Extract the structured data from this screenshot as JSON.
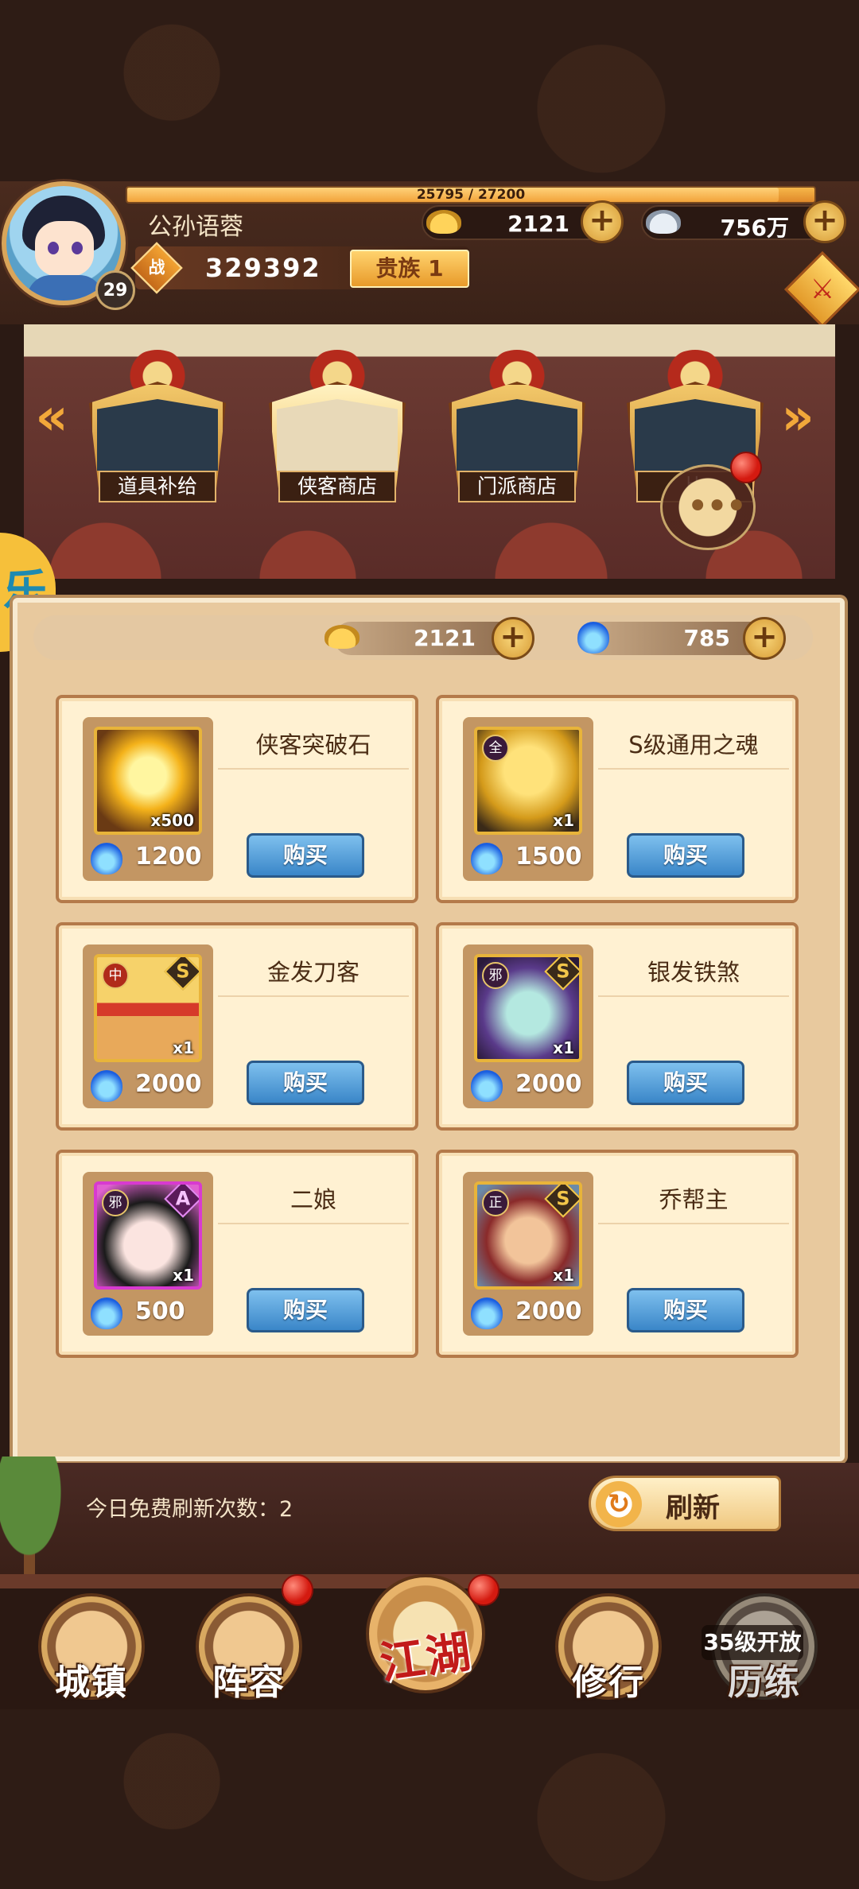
{
  "player": {
    "name": "公孙语蓉",
    "level": "29",
    "exp_text": "25795 / 27200",
    "exp_fraction": 0.948,
    "power_label": "战",
    "power": "329392",
    "noble": "贵族 1"
  },
  "currencies": {
    "gold_ingot": "2121",
    "silver": "756万",
    "plus": "+"
  },
  "side_pendant": "⚔",
  "shop_tabs": [
    {
      "label": "道具补给",
      "active": false
    },
    {
      "label": "侠客商店",
      "active": true
    },
    {
      "label": "门派商店",
      "active": false
    },
    {
      "label": "比武商店",
      "active": false
    }
  ],
  "shop_tab_visible_label_4": "比",
  "nav_arrows": {
    "left": "«",
    "right": "»"
  },
  "chat_icon": "•••",
  "shop_currency": {
    "gold_ingot": "2121",
    "soul": "785"
  },
  "items": [
    {
      "name": "侠客突破石",
      "qty": "x500",
      "price": "1200",
      "faction": "",
      "grade": "",
      "art": "stone"
    },
    {
      "name": "S级通用之魂",
      "qty": "x1",
      "price": "1500",
      "faction": "全",
      "grade": "",
      "art": "soul"
    },
    {
      "name": "金发刀客",
      "qty": "x1",
      "price": "2000",
      "faction": "中",
      "grade": "S",
      "art": "jinfa"
    },
    {
      "name": "银发铁煞",
      "qty": "x1",
      "price": "2000",
      "faction": "邪",
      "grade": "S",
      "art": "yinfa"
    },
    {
      "name": "二娘",
      "qty": "x1",
      "price": "500",
      "faction": "邪",
      "grade": "A",
      "art": "erniang"
    },
    {
      "name": "乔帮主",
      "qty": "x1",
      "price": "2000",
      "faction": "正",
      "grade": "S",
      "art": "qiao"
    }
  ],
  "buy_label": "购买",
  "refresh": {
    "free_text": "今日免费刷新次数：2",
    "button_label": "刷新",
    "icon": "↻"
  },
  "nav": [
    {
      "label": "城镇",
      "badge": false
    },
    {
      "label": "阵容",
      "badge": true
    },
    {
      "label": "江湖",
      "badge": true
    },
    {
      "label": "修行",
      "badge": false
    },
    {
      "label": "历练",
      "badge": false,
      "lock_text": "35级开放"
    }
  ],
  "colors": {
    "accent_gold": "#f2b44a",
    "buy_button": "#3a86c8",
    "badge_red": "#d41a10",
    "panel_bg": "#e8c99e"
  }
}
